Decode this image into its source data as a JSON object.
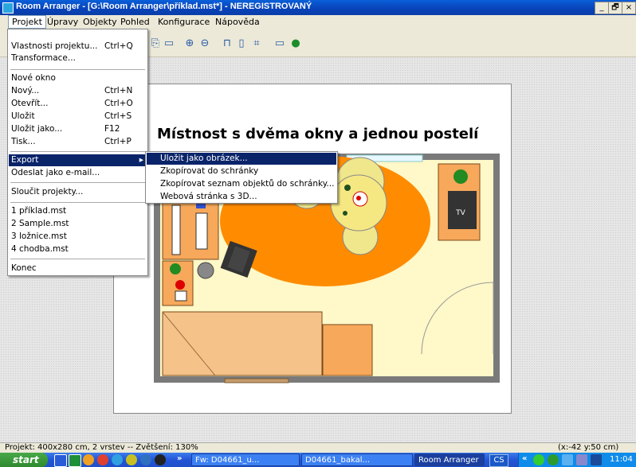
{
  "window": {
    "title": "Room Arranger - [G:\\Room Arranger\\příklad.mst*] - NEREGISTROVANÝ",
    "min": "_",
    "max": "🗗",
    "close": "×"
  },
  "menubar": [
    "Projekt",
    "Úpravy",
    "Objekty",
    "Pohled",
    "Konfigurace",
    "Nápověda"
  ],
  "project_menu": {
    "items": [
      {
        "label": "Vlastnosti projektu...",
        "shortcut": "Ctrl+Q"
      },
      {
        "label": "Transformace...",
        "shortcut": ""
      },
      {
        "label": "Nové okno",
        "shortcut": ""
      },
      {
        "label": "Nový...",
        "shortcut": "Ctrl+N"
      },
      {
        "label": "Otevřít...",
        "shortcut": "Ctrl+O"
      },
      {
        "label": "Uložit",
        "shortcut": "Ctrl+S"
      },
      {
        "label": "Uložit jako...",
        "shortcut": "F12"
      },
      {
        "label": "Tisk...",
        "shortcut": "Ctrl+P"
      },
      {
        "label": "Export",
        "shortcut": ""
      },
      {
        "label": "Odeslat jako e-mail...",
        "shortcut": ""
      },
      {
        "label": "Sloučit projekty...",
        "shortcut": ""
      },
      {
        "label": "1 příklad.mst",
        "shortcut": ""
      },
      {
        "label": "2 Sample.mst",
        "shortcut": ""
      },
      {
        "label": "3 ložnice.mst",
        "shortcut": ""
      },
      {
        "label": "4 chodba.mst",
        "shortcut": ""
      },
      {
        "label": "Konec",
        "shortcut": ""
      }
    ],
    "export_arrow": "▸"
  },
  "export_submenu": [
    "Uložit jako obrázek...",
    "Zkopírovat do schránky",
    "Zkopírovat seznam objektů do schránky...",
    "Webová stránka s 3D..."
  ],
  "canvas": {
    "room_title": "Místnost s dvěma okny a jednou postelí",
    "tv_label": "TV"
  },
  "statusbar": {
    "left": "Projekt: 400x280 cm, 2 vrstev -- Zvětšení: 130%",
    "right": "(x:-42 y:50 cm)"
  },
  "taskbar": {
    "start": "start",
    "chevron": "»",
    "tasks": [
      "Fw: D04661_u...",
      "D04661_bakal...",
      "Room Arranger"
    ],
    "lang": "CS",
    "tray_chevron": "«",
    "clock": "11:04"
  },
  "colors": {
    "selection": "#0a246a",
    "floor": "#fff8c8",
    "rug": "#ff8c00",
    "wall": "#7a7a7a"
  }
}
